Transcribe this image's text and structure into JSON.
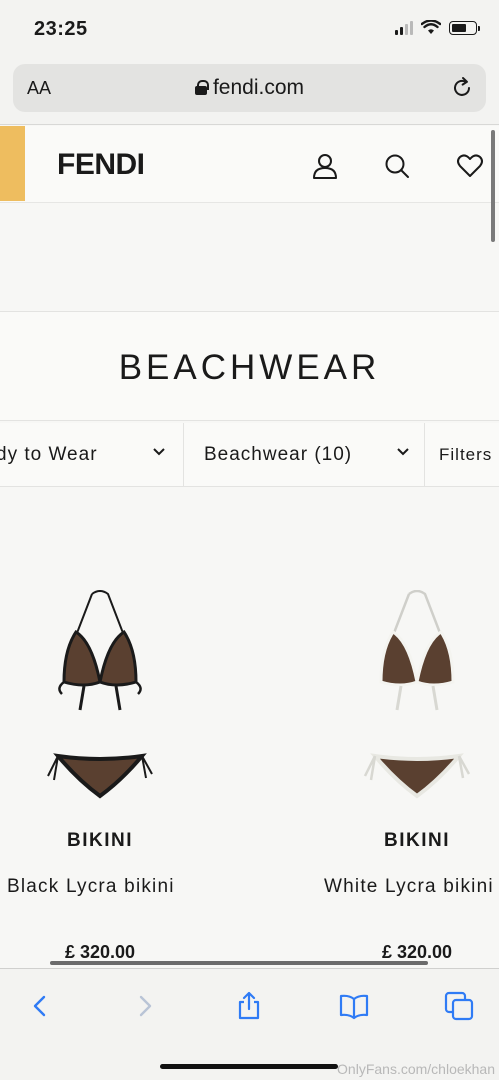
{
  "status_bar": {
    "time": "23:25",
    "signal_bars": 2,
    "battery_level": 0.62
  },
  "browser": {
    "text_size_label": "AA",
    "url": "fendi.com"
  },
  "site": {
    "logo": "FENDI"
  },
  "page": {
    "title": "BEACHWEAR"
  },
  "filters": [
    {
      "label": "dy to Wear"
    },
    {
      "label": "Beachwear (10)"
    },
    {
      "label": "Filters"
    }
  ],
  "products": [
    {
      "category": "BIKINI",
      "name": "Black Lycra bikini",
      "price": "£ 320.00",
      "trim_color": "#1a1a1a"
    },
    {
      "category": "BIKINI",
      "name": "White Lycra bikini",
      "price": "£ 320.00",
      "trim_color": "#f4f4f0"
    }
  ],
  "colors": {
    "accent": "#eebd5f",
    "ff_pattern": "#5a4030"
  },
  "watermark": "OnlyFans.com/chloekhan",
  "icons": [
    "signal-icon",
    "wifi-icon",
    "battery-icon",
    "lock-icon",
    "reload-icon",
    "account-icon",
    "search-icon",
    "heart-icon",
    "chevron-down-icon",
    "back-icon",
    "forward-icon",
    "share-icon",
    "bookmarks-icon",
    "tabs-icon"
  ]
}
